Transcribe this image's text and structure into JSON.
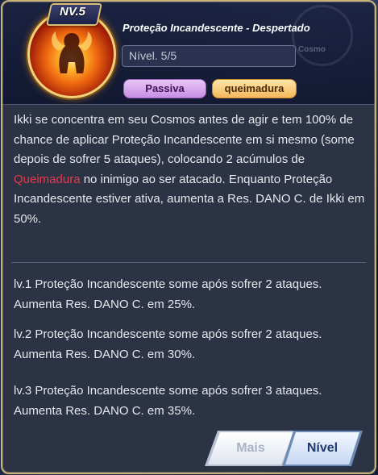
{
  "header": {
    "level_badge": "NV.5",
    "skill_name": "Proteção Incandescente - Despertado",
    "level_field": "Nível. 5/5",
    "tags": [
      "Passiva",
      "queimadura"
    ],
    "watermark_text": "Cosmo"
  },
  "description": {
    "part1": "Ikki se concentra em seu Cosmos antes de agir e tem 100% de chance de aplicar Proteção Incandescente em si mesmo (some depois de sofrer 5 ataques), colocando 2 acúmulos de ",
    "highlight": "Queimadura",
    "part2": " no inimigo ao ser atacado. Enquanto Proteção Incandescente estiver ativa, aumenta a Res. DANO C. de Ikki em 50%.",
    "highlight_color": "#e7394a"
  },
  "levels": [
    "lv.1 Proteção Incandescente some após sofrer 2 ataques. Aumenta Res. DANO C. em 25%.",
    "lv.2 Proteção Incandescente some após sofrer 2 ataques. Aumenta Res. DANO C. em 30%.",
    "lv.3 Proteção Incandescente some após sofrer 3 ataques. Aumenta Res. DANO C. em 35%."
  ],
  "buttons": {
    "more_label": "Mais",
    "level_label": "Nível"
  },
  "colors": {
    "border_gold": "#c9b27a",
    "passiva_tag": "#c68fe4",
    "queimadura_tag": "#f3b85c"
  }
}
